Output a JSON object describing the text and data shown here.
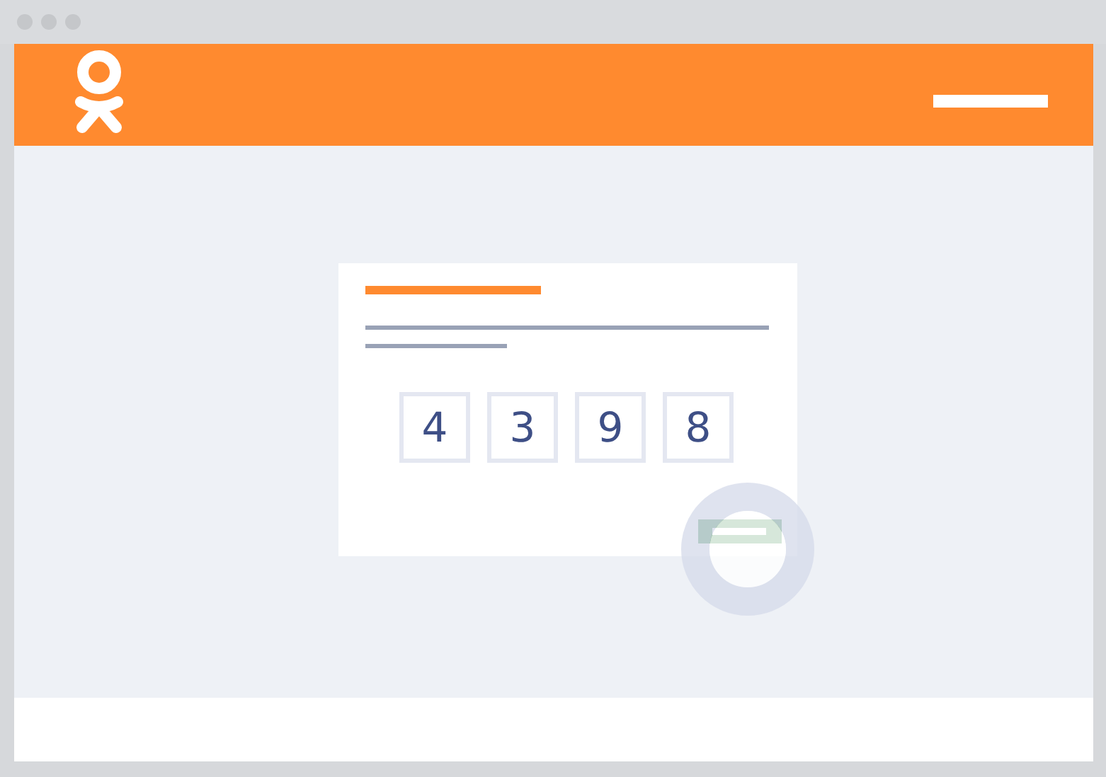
{
  "code_boxes": [
    {
      "digit": "4"
    },
    {
      "digit": "3"
    },
    {
      "digit": "9"
    },
    {
      "digit": "8"
    }
  ]
}
